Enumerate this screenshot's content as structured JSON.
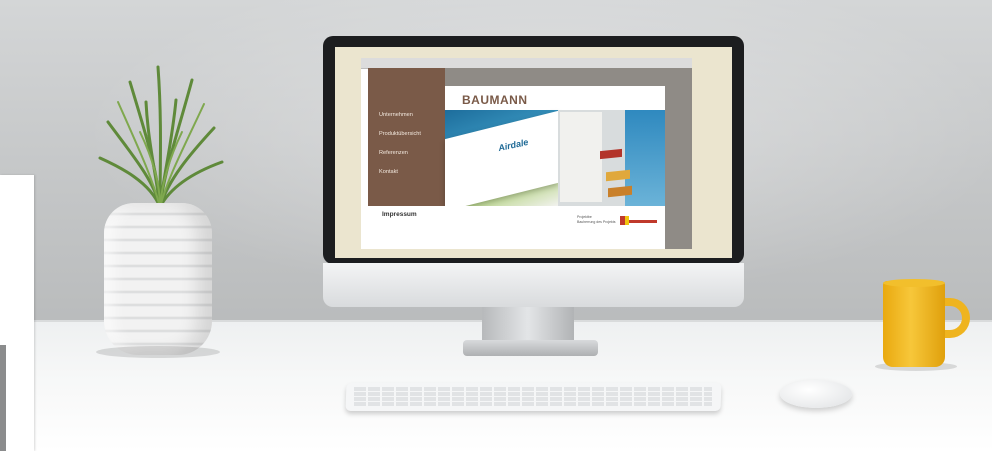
{
  "website": {
    "brand": "BAUMANN",
    "nav_items": [
      "Unternehmen",
      "Produktübersicht",
      "Referenzen",
      "Kontakt"
    ],
    "footer_link": "Impressum",
    "footer_note_line1": "Projektbe",
    "footer_note_line2": "Bauherrung des Projekts",
    "banner_text": "Airdale"
  },
  "colors": {
    "nav_brown": "#7a5a48",
    "mug_yellow": "#f7c73a",
    "wall_gray": "#c9cbcc"
  },
  "objects": [
    "plant-in-ribbed-white-pot",
    "desktop-monitor",
    "keyboard",
    "mouse",
    "yellow-mug"
  ]
}
